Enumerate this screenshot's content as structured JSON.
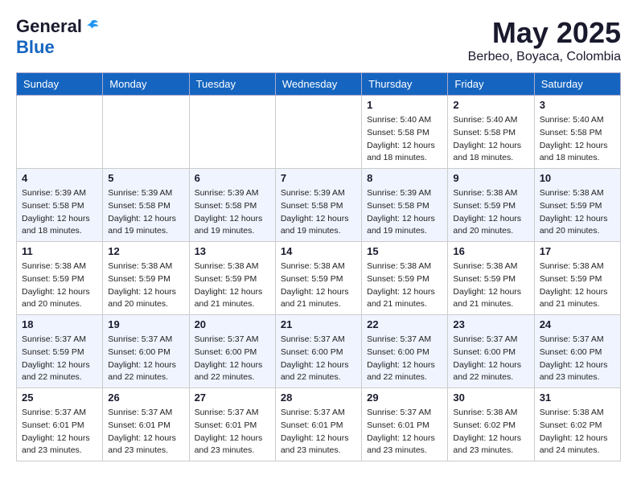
{
  "header": {
    "logo": {
      "line1": "General",
      "line2": "Blue"
    },
    "month": "May 2025",
    "location": "Berbeo, Boyaca, Colombia"
  },
  "weekdays": [
    "Sunday",
    "Monday",
    "Tuesday",
    "Wednesday",
    "Thursday",
    "Friday",
    "Saturday"
  ],
  "weeks": [
    [
      {
        "day": "",
        "sunrise": "",
        "sunset": "",
        "daylight": ""
      },
      {
        "day": "",
        "sunrise": "",
        "sunset": "",
        "daylight": ""
      },
      {
        "day": "",
        "sunrise": "",
        "sunset": "",
        "daylight": ""
      },
      {
        "day": "",
        "sunrise": "",
        "sunset": "",
        "daylight": ""
      },
      {
        "day": "1",
        "sunrise": "Sunrise: 5:40 AM",
        "sunset": "Sunset: 5:58 PM",
        "daylight": "Daylight: 12 hours and 18 minutes."
      },
      {
        "day": "2",
        "sunrise": "Sunrise: 5:40 AM",
        "sunset": "Sunset: 5:58 PM",
        "daylight": "Daylight: 12 hours and 18 minutes."
      },
      {
        "day": "3",
        "sunrise": "Sunrise: 5:40 AM",
        "sunset": "Sunset: 5:58 PM",
        "daylight": "Daylight: 12 hours and 18 minutes."
      }
    ],
    [
      {
        "day": "4",
        "sunrise": "Sunrise: 5:39 AM",
        "sunset": "Sunset: 5:58 PM",
        "daylight": "Daylight: 12 hours and 18 minutes."
      },
      {
        "day": "5",
        "sunrise": "Sunrise: 5:39 AM",
        "sunset": "Sunset: 5:58 PM",
        "daylight": "Daylight: 12 hours and 19 minutes."
      },
      {
        "day": "6",
        "sunrise": "Sunrise: 5:39 AM",
        "sunset": "Sunset: 5:58 PM",
        "daylight": "Daylight: 12 hours and 19 minutes."
      },
      {
        "day": "7",
        "sunrise": "Sunrise: 5:39 AM",
        "sunset": "Sunset: 5:58 PM",
        "daylight": "Daylight: 12 hours and 19 minutes."
      },
      {
        "day": "8",
        "sunrise": "Sunrise: 5:39 AM",
        "sunset": "Sunset: 5:58 PM",
        "daylight": "Daylight: 12 hours and 19 minutes."
      },
      {
        "day": "9",
        "sunrise": "Sunrise: 5:38 AM",
        "sunset": "Sunset: 5:59 PM",
        "daylight": "Daylight: 12 hours and 20 minutes."
      },
      {
        "day": "10",
        "sunrise": "Sunrise: 5:38 AM",
        "sunset": "Sunset: 5:59 PM",
        "daylight": "Daylight: 12 hours and 20 minutes."
      }
    ],
    [
      {
        "day": "11",
        "sunrise": "Sunrise: 5:38 AM",
        "sunset": "Sunset: 5:59 PM",
        "daylight": "Daylight: 12 hours and 20 minutes."
      },
      {
        "day": "12",
        "sunrise": "Sunrise: 5:38 AM",
        "sunset": "Sunset: 5:59 PM",
        "daylight": "Daylight: 12 hours and 20 minutes."
      },
      {
        "day": "13",
        "sunrise": "Sunrise: 5:38 AM",
        "sunset": "Sunset: 5:59 PM",
        "daylight": "Daylight: 12 hours and 21 minutes."
      },
      {
        "day": "14",
        "sunrise": "Sunrise: 5:38 AM",
        "sunset": "Sunset: 5:59 PM",
        "daylight": "Daylight: 12 hours and 21 minutes."
      },
      {
        "day": "15",
        "sunrise": "Sunrise: 5:38 AM",
        "sunset": "Sunset: 5:59 PM",
        "daylight": "Daylight: 12 hours and 21 minutes."
      },
      {
        "day": "16",
        "sunrise": "Sunrise: 5:38 AM",
        "sunset": "Sunset: 5:59 PM",
        "daylight": "Daylight: 12 hours and 21 minutes."
      },
      {
        "day": "17",
        "sunrise": "Sunrise: 5:38 AM",
        "sunset": "Sunset: 5:59 PM",
        "daylight": "Daylight: 12 hours and 21 minutes."
      }
    ],
    [
      {
        "day": "18",
        "sunrise": "Sunrise: 5:37 AM",
        "sunset": "Sunset: 5:59 PM",
        "daylight": "Daylight: 12 hours and 22 minutes."
      },
      {
        "day": "19",
        "sunrise": "Sunrise: 5:37 AM",
        "sunset": "Sunset: 6:00 PM",
        "daylight": "Daylight: 12 hours and 22 minutes."
      },
      {
        "day": "20",
        "sunrise": "Sunrise: 5:37 AM",
        "sunset": "Sunset: 6:00 PM",
        "daylight": "Daylight: 12 hours and 22 minutes."
      },
      {
        "day": "21",
        "sunrise": "Sunrise: 5:37 AM",
        "sunset": "Sunset: 6:00 PM",
        "daylight": "Daylight: 12 hours and 22 minutes."
      },
      {
        "day": "22",
        "sunrise": "Sunrise: 5:37 AM",
        "sunset": "Sunset: 6:00 PM",
        "daylight": "Daylight: 12 hours and 22 minutes."
      },
      {
        "day": "23",
        "sunrise": "Sunrise: 5:37 AM",
        "sunset": "Sunset: 6:00 PM",
        "daylight": "Daylight: 12 hours and 22 minutes."
      },
      {
        "day": "24",
        "sunrise": "Sunrise: 5:37 AM",
        "sunset": "Sunset: 6:00 PM",
        "daylight": "Daylight: 12 hours and 23 minutes."
      }
    ],
    [
      {
        "day": "25",
        "sunrise": "Sunrise: 5:37 AM",
        "sunset": "Sunset: 6:01 PM",
        "daylight": "Daylight: 12 hours and 23 minutes."
      },
      {
        "day": "26",
        "sunrise": "Sunrise: 5:37 AM",
        "sunset": "Sunset: 6:01 PM",
        "daylight": "Daylight: 12 hours and 23 minutes."
      },
      {
        "day": "27",
        "sunrise": "Sunrise: 5:37 AM",
        "sunset": "Sunset: 6:01 PM",
        "daylight": "Daylight: 12 hours and 23 minutes."
      },
      {
        "day": "28",
        "sunrise": "Sunrise: 5:37 AM",
        "sunset": "Sunset: 6:01 PM",
        "daylight": "Daylight: 12 hours and 23 minutes."
      },
      {
        "day": "29",
        "sunrise": "Sunrise: 5:37 AM",
        "sunset": "Sunset: 6:01 PM",
        "daylight": "Daylight: 12 hours and 23 minutes."
      },
      {
        "day": "30",
        "sunrise": "Sunrise: 5:38 AM",
        "sunset": "Sunset: 6:02 PM",
        "daylight": "Daylight: 12 hours and 23 minutes."
      },
      {
        "day": "31",
        "sunrise": "Sunrise: 5:38 AM",
        "sunset": "Sunset: 6:02 PM",
        "daylight": "Daylight: 12 hours and 24 minutes."
      }
    ]
  ]
}
